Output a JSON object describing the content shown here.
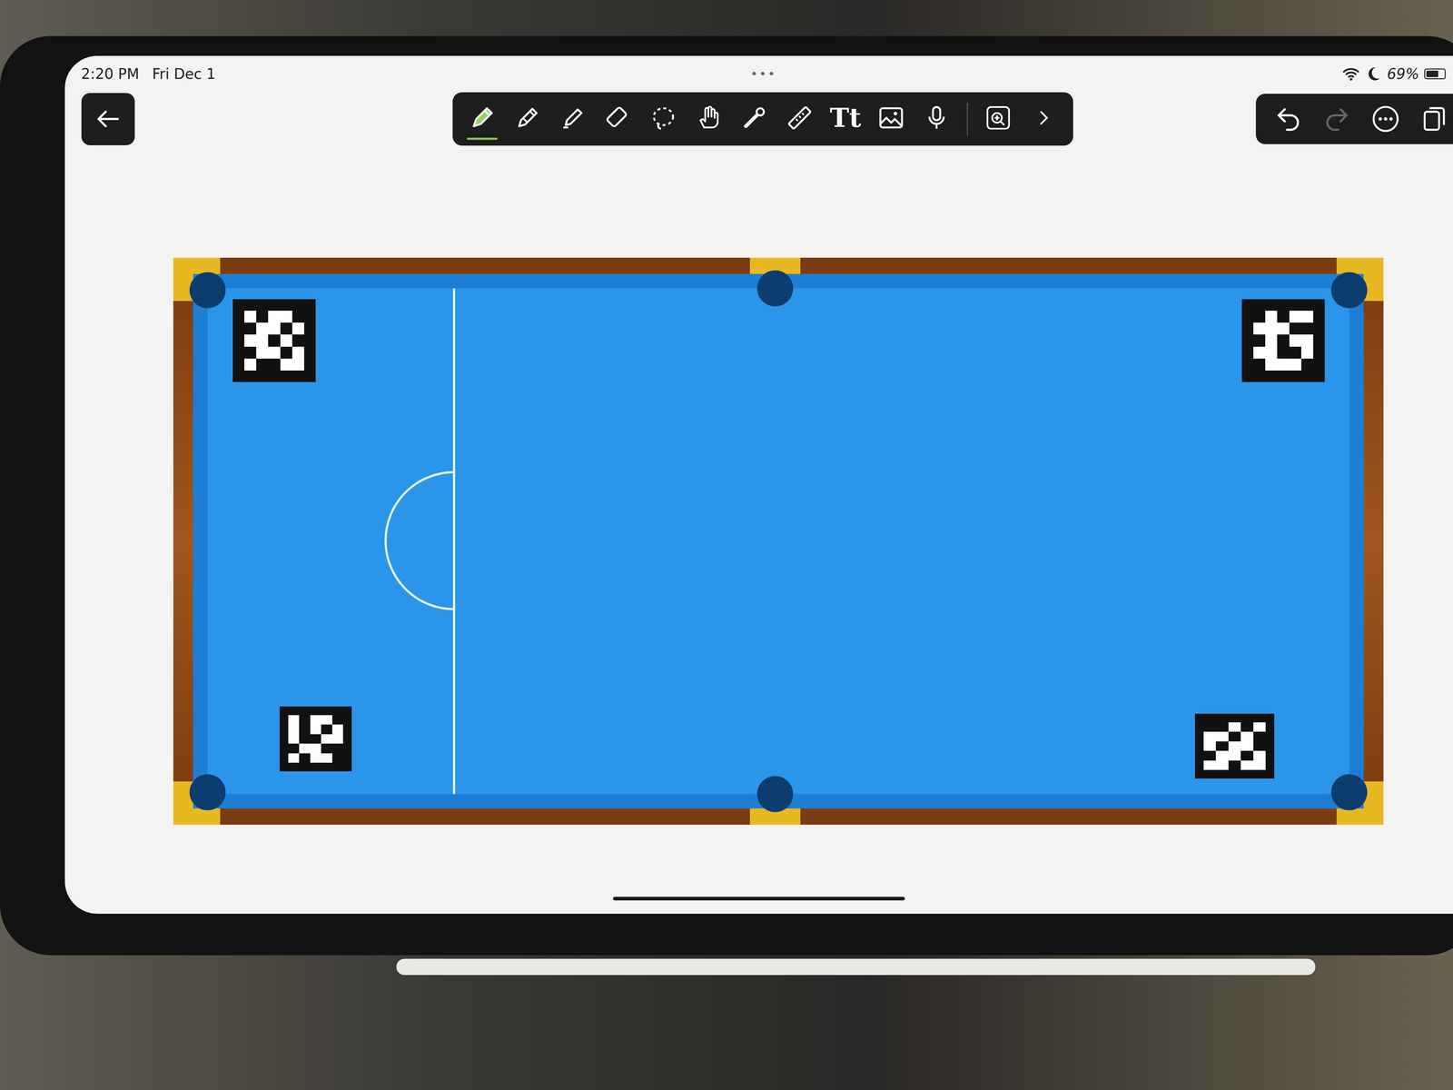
{
  "status_bar": {
    "time": "2:20 PM",
    "date": "Fri Dec 1",
    "battery": "69%",
    "battery_level": 0.69,
    "wifi": true,
    "focus_moon": true
  },
  "multitask": "•••",
  "toolbar": {
    "tools": [
      {
        "kind": "pen",
        "selected": true
      },
      {
        "kind": "pencil",
        "selected": false
      },
      {
        "kind": "highlighter",
        "selected": false
      },
      {
        "kind": "eraser",
        "selected": false
      },
      {
        "kind": "lasso",
        "selected": false
      },
      {
        "kind": "hand",
        "selected": false
      },
      {
        "kind": "laser",
        "selected": false
      },
      {
        "kind": "ruler",
        "selected": false
      },
      {
        "kind": "text",
        "label": "Tt",
        "selected": false
      },
      {
        "kind": "image",
        "selected": false
      },
      {
        "kind": "mic",
        "selected": false
      },
      {
        "kind": "zoom",
        "selected": false
      },
      {
        "kind": "more",
        "selected": false
      }
    ]
  },
  "history": {
    "undo_enabled": true,
    "redo_enabled": false
  }
}
